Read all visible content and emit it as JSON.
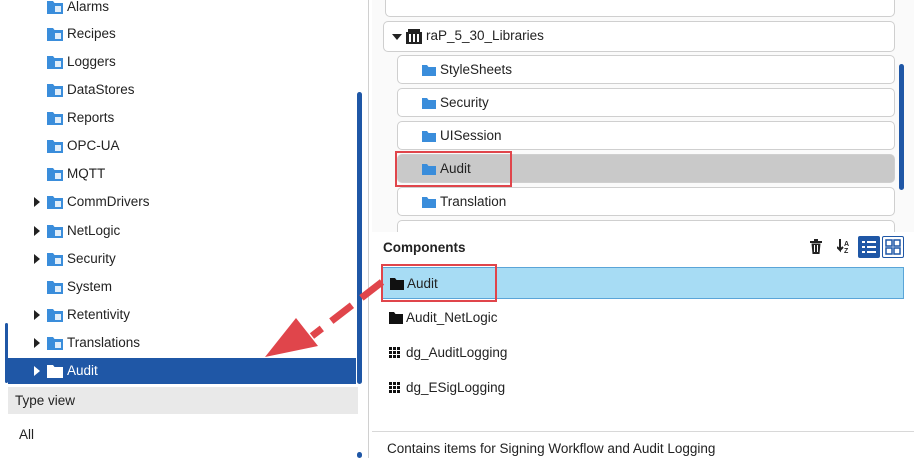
{
  "left_tree": {
    "items": [
      {
        "label": "Alarms",
        "expandable": false
      },
      {
        "label": "Recipes",
        "expandable": false
      },
      {
        "label": "Loggers",
        "expandable": false
      },
      {
        "label": "DataStores",
        "expandable": false
      },
      {
        "label": "Reports",
        "expandable": false
      },
      {
        "label": "OPC-UA",
        "expandable": false
      },
      {
        "label": "MQTT",
        "expandable": false
      },
      {
        "label": "CommDrivers",
        "expandable": true
      },
      {
        "label": "NetLogic",
        "expandable": true
      },
      {
        "label": "Security",
        "expandable": true
      },
      {
        "label": "System",
        "expandable": false
      },
      {
        "label": "Retentivity",
        "expandable": true
      },
      {
        "label": "Translations",
        "expandable": true
      },
      {
        "label": "Audit",
        "expandable": true,
        "selected": true
      }
    ],
    "type_view_label": "Type view",
    "all_label": "All"
  },
  "library": {
    "root_label": "raP_5_30_Libraries",
    "folders": [
      {
        "label": "StyleSheets"
      },
      {
        "label": "Security"
      },
      {
        "label": "UISession"
      },
      {
        "label": "Audit",
        "selected": true
      },
      {
        "label": "Translation"
      }
    ]
  },
  "components": {
    "title": "Components",
    "items": [
      {
        "label": "Audit",
        "icon": "folder-icon",
        "selected": true
      },
      {
        "label": "Audit_NetLogic",
        "icon": "folder-icon"
      },
      {
        "label": "dg_AuditLogging",
        "icon": "grid-dots-icon"
      },
      {
        "label": "dg_ESigLogging",
        "icon": "grid-dots-icon"
      }
    ],
    "description": "Contains items for Signing Workflow and Audit Logging"
  },
  "colors": {
    "selection_blue": "#1f57a6",
    "component_selected": "#a7dcf4",
    "highlight_red": "#e0454b",
    "folder_blue": "#3a8ddb"
  }
}
